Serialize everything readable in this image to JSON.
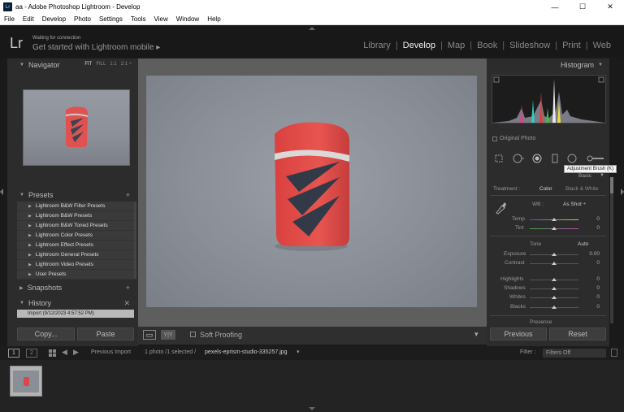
{
  "window": {
    "title": "aa - Adobe Photoshop Lightroom - Develop",
    "app_icon": "Lr",
    "controls": [
      "—",
      "☐",
      "✕"
    ]
  },
  "menubar": [
    "File",
    "Edit",
    "Develop",
    "Photo",
    "Settings",
    "Tools",
    "View",
    "Window",
    "Help"
  ],
  "identity": {
    "logo": "Lr",
    "status": "Waiting for connection",
    "get_started": "Get started with Lightroom mobile  ▸"
  },
  "modules": {
    "items": [
      "Library",
      "Develop",
      "Map",
      "Book",
      "Slideshow",
      "Print",
      "Web"
    ],
    "active": "Develop",
    "separator": "|"
  },
  "left_panel": {
    "navigator": {
      "title": "Navigator",
      "options": [
        "FIT",
        "FILL",
        "1:1",
        "2:1 ÷"
      ],
      "selected": "FIT"
    },
    "presets": {
      "title": "Presets",
      "add": "+",
      "items": [
        "Lightroom B&W Filter Presets",
        "Lightroom B&W Presets",
        "Lightroom B&W Toned Presets",
        "Lightroom Color Presets",
        "Lightroom Effect Presets",
        "Lightroom General Presets",
        "Lightroom Video Presets",
        "User Presets"
      ]
    },
    "snapshots": {
      "title": "Snapshots",
      "add": "+"
    },
    "history": {
      "title": "History",
      "clear": "✕",
      "items": [
        "Import (9/12/2023 4:57:52 PM)"
      ]
    },
    "copy_button": "Copy...",
    "paste_button": "Paste"
  },
  "toolbar": {
    "view_icon": "▭",
    "yy_label": "Y|Y",
    "soft_proofing_label": "Soft Proofing",
    "menu_arrow": "▾"
  },
  "right_panel": {
    "histogram_title": "Histogram",
    "original_photo_label": "Original Photo",
    "tooltip": "Adjustment Brush (K)",
    "basic_label": "Basic",
    "treatment_label": "Treatment :",
    "treatment_color": "Color",
    "treatment_bw": "Black & White",
    "wb_label": "WB :",
    "wb_value": "As Shot ÷",
    "temp_label": "Temp",
    "temp_value": "0",
    "tint_label": "Tint",
    "tint_value": "0",
    "tone_label": "Tone",
    "auto_label": "Auto",
    "exposure_label": "Exposure",
    "exposure_value": "0.00",
    "contrast_label": "Contrast",
    "contrast_value": "0",
    "highlights_label": "Highlights",
    "highlights_value": "0",
    "shadows_label": "Shadows",
    "shadows_value": "0",
    "whites_label": "Whites",
    "whites_value": "0",
    "blacks_label": "Blacks",
    "blacks_value": "0",
    "presence_label": "Presence",
    "previous_button": "Previous",
    "reset_button": "Reset"
  },
  "filmstrip": {
    "page1": "1",
    "page2": "2",
    "source": "Previous Import",
    "info": "1 photo /1 selected /",
    "filename": "pexels-eprism-studio-335257.jpg",
    "filter_label": "Filter :",
    "filter_value": "Filters Off"
  }
}
